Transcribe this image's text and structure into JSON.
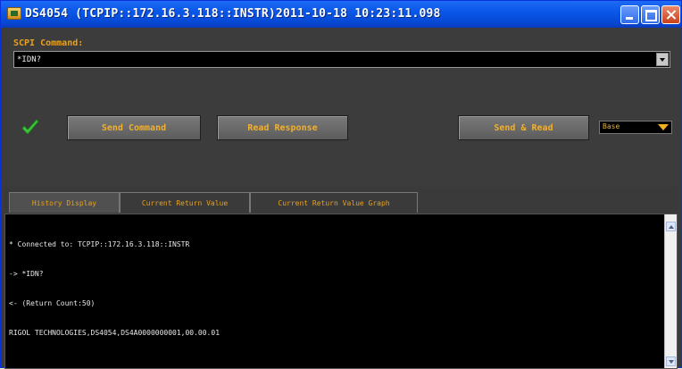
{
  "window": {
    "title": "DS4054 (TCPIP::172.16.3.118::INSTR)2011-10-18 10:23:11.098",
    "app_icon": "instrument-app-icon"
  },
  "command": {
    "label": "SCPI Command:",
    "value": "*IDN?"
  },
  "buttons": {
    "send": "Send Command",
    "read": "Read Response",
    "send_read": "Send & Read"
  },
  "base": {
    "selected": "Base"
  },
  "tabs": [
    {
      "label": "History Display"
    },
    {
      "label": "Current Return Value"
    },
    {
      "label": "Current Return Value Graph"
    }
  ],
  "history": {
    "lines": [
      "* Connected to: TCPIP::172.16.3.118::INSTR",
      "-> *IDN?",
      "<- (Return Count:50)",
      "RIGOL TECHNOLOGIES,DS4054,DS4A0000000001,00.00.01"
    ]
  },
  "colors": {
    "accent": "#e8a020",
    "titlebar": "#0a57e8",
    "status_ok": "#3cc43c"
  }
}
